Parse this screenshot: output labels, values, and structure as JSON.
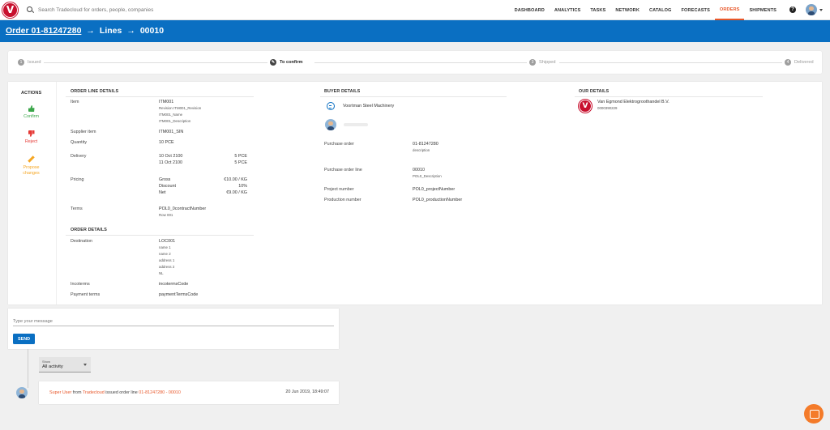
{
  "search": {
    "placeholder": "Search Tradecloud for orders, people, companies"
  },
  "nav": {
    "items": [
      "DASHBOARD",
      "ANALYTICS",
      "TASKS",
      "NETWORK",
      "CATALOG",
      "FORECASTS",
      "ORDERS",
      "SHIPMENTS"
    ],
    "active": "ORDERS",
    "help": "?"
  },
  "breadcrumb": {
    "order": "Order 01-81247280",
    "arrow1": "→",
    "lines": "Lines",
    "arrow2": "→",
    "line": "00010"
  },
  "stepper": [
    {
      "num": "1",
      "label": "Issued"
    },
    {
      "num": "",
      "label": "To confirm"
    },
    {
      "num": "3",
      "label": "Shipped"
    },
    {
      "num": "4",
      "label": "Delivered"
    }
  ],
  "actions": {
    "title": "ACTIONS",
    "confirm": "Confirm",
    "reject": "Reject",
    "propose_1": "Propose",
    "propose_2": "changes"
  },
  "order_line": {
    "title": "ORDER LINE DETAILS",
    "item_label": "Item",
    "item": "ITM001",
    "item_revision": "Revision ITM001_Revision",
    "item_name": "ITM001_Name",
    "item_description": "ITM001_Description",
    "supplier_item_label": "Supplier item",
    "supplier_item": "ITM001_SIN",
    "quantity_label": "Quantity",
    "quantity": "10 PCE",
    "delivery_label": "Delivery",
    "delivery_1_date": "10 Oct 2100",
    "delivery_1_qty": "5 PCE",
    "delivery_2_date": "11 Oct 2100",
    "delivery_2_qty": "5 PCE",
    "pricing_label": "Pricing",
    "gross_label": "Gross",
    "gross": "€10.00 / KG",
    "discount_label": "Discount",
    "discount": "10%",
    "net_label": "Net",
    "net": "€9.00 / KG",
    "terms_label": "Terms",
    "terms": "POL0_0contractNumber",
    "terms_row": "Row 001"
  },
  "order_details": {
    "title": "ORDER DETAILS",
    "destination_label": "Destination",
    "destination": "LOC001",
    "name1": "name 1",
    "name2": "name 2",
    "address1": "address 1",
    "address2": "address 2",
    "country": "NL",
    "incoterms_label": "Incoterms",
    "incoterms": "incotermsCode",
    "payment_label": "Payment terms",
    "payment": "paymentTermsCode"
  },
  "buyer": {
    "title": "BUYER DETAILS",
    "company": "Voortman Steel Machinery",
    "po_label": "Purchase order",
    "po": "01-81247280",
    "po_desc": "description",
    "pol_label": "Purchase order line",
    "pol": "00010",
    "pol_desc": "POL0_Description",
    "project_label": "Project number",
    "project": "POL0_projectNumber",
    "production_label": "Production number",
    "production": "POL0_productionNumber"
  },
  "ours": {
    "title": "OUR DETAILS",
    "company": "Van Egmond Elektrogroothandel B.V.",
    "code": "0000390229"
  },
  "message": {
    "placeholder": "Type your message",
    "send": "SEND"
  },
  "filter": {
    "label": "Show",
    "value": "All activity"
  },
  "activity": {
    "user": "Super User",
    "from": " from ",
    "company": "Tradecloud",
    "action": " issued order line ",
    "ref": "01-81247280 - 00010",
    "time": "20 Jun 2019, 18:49:07"
  },
  "colors": {
    "brand_blue": "#0a6fc2",
    "accent_orange": "#e8572a",
    "confirm_green": "#3aa649",
    "reject_red": "#e53935",
    "propose_amber": "#f5a623"
  }
}
